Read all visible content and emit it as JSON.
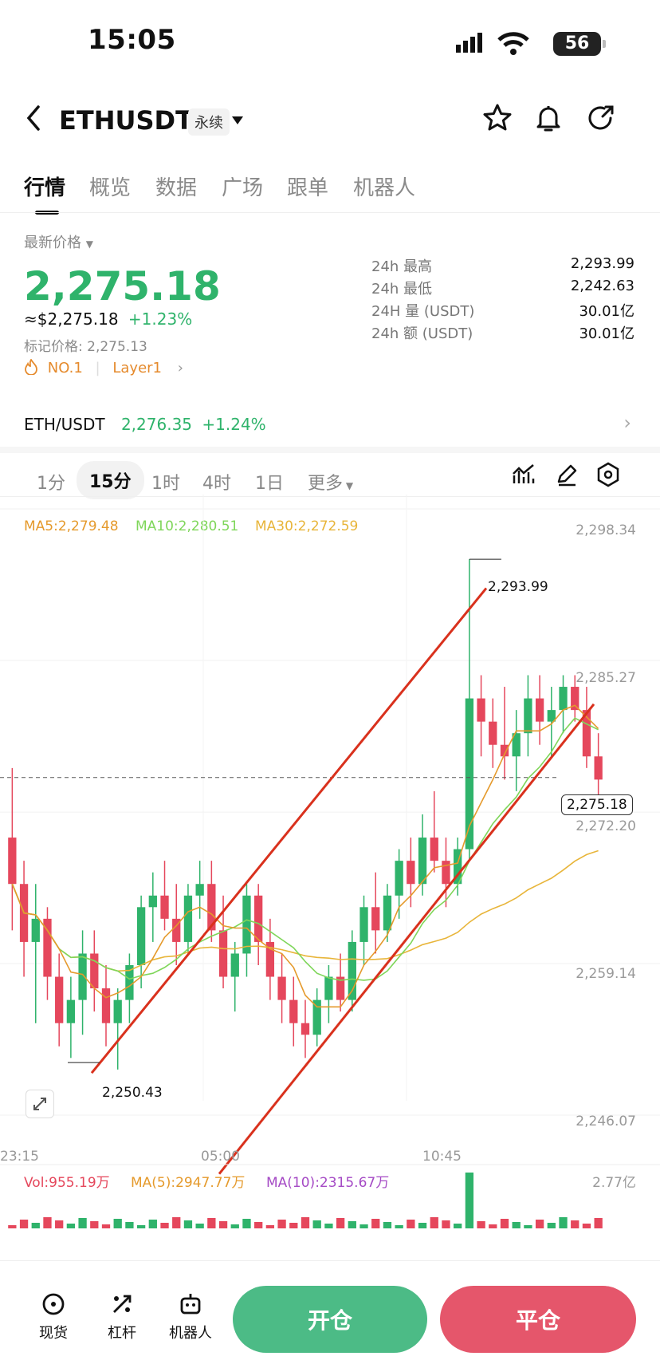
{
  "status": {
    "time": "15:05",
    "battery": "56"
  },
  "header": {
    "symbol": "ETHUSDT",
    "contract_tag": "永续"
  },
  "tabs": [
    {
      "label": "行情",
      "active": true
    },
    {
      "label": "概览"
    },
    {
      "label": "数据"
    },
    {
      "label": "广场"
    },
    {
      "label": "跟单"
    },
    {
      "label": "机器人"
    }
  ],
  "price": {
    "latest_label": "最新价格",
    "last": "2,275.18",
    "usd": "≈$2,275.18",
    "change": "+1.23%",
    "mark": "标记价格: 2,275.13",
    "rank": "NO.1",
    "sector": "Layer1"
  },
  "stats": [
    {
      "label": "24h  最高",
      "value": "2,293.99"
    },
    {
      "label": "24h  最低",
      "value": "2,242.63"
    },
    {
      "label": "24H  量 (USDT)",
      "value": "30.01亿"
    },
    {
      "label": "24h  额 (USDT)",
      "value": "30.01亿"
    }
  ],
  "spot": {
    "pair": "ETH/USDT",
    "price": "2,276.35",
    "change": "+1.24%"
  },
  "intervals": [
    {
      "label": "1分"
    },
    {
      "label": "15分",
      "active": true
    },
    {
      "label": "1时"
    },
    {
      "label": "4时"
    },
    {
      "label": "1日"
    },
    {
      "label": "更多"
    }
  ],
  "ma": {
    "ma5": "MA5:2,279.48",
    "ma10": "MA10:2,280.51",
    "ma30": "MA30:2,272.59"
  },
  "chart_data": {
    "type": "candlestick",
    "y_ticks": [
      "2,298.34",
      "2,285.27",
      "2,272.20",
      "2,259.14",
      "2,246.07"
    ],
    "ylim": [
      2246.07,
      2298.34
    ],
    "x_ticks": [
      "23:15",
      "05:00",
      "10:45"
    ],
    "current_price": "2,275.18",
    "high_marker": "2,293.99",
    "low_marker": "2,250.43",
    "candles": [
      [
        2270,
        2276,
        2262,
        2266
      ],
      [
        2266,
        2268,
        2258,
        2261
      ],
      [
        2261,
        2266,
        2254,
        2263
      ],
      [
        2263,
        2264,
        2256,
        2258
      ],
      [
        2258,
        2260,
        2252,
        2254
      ],
      [
        2254,
        2258,
        2251,
        2256
      ],
      [
        2256,
        2262,
        2253,
        2260
      ],
      [
        2260,
        2262,
        2255,
        2257
      ],
      [
        2257,
        2259,
        2252,
        2254
      ],
      [
        2254,
        2257,
        2250,
        2256
      ],
      [
        2256,
        2260,
        2254,
        2259
      ],
      [
        2259,
        2265,
        2257,
        2264
      ],
      [
        2264,
        2267,
        2261,
        2265
      ],
      [
        2265,
        2268,
        2262,
        2263
      ],
      [
        2263,
        2266,
        2259,
        2261
      ],
      [
        2261,
        2266,
        2260,
        2265
      ],
      [
        2265,
        2268,
        2263,
        2266
      ],
      [
        2266,
        2268,
        2261,
        2262
      ],
      [
        2262,
        2265,
        2257,
        2258
      ],
      [
        2258,
        2261,
        2255,
        2260
      ],
      [
        2260,
        2266,
        2258,
        2265
      ],
      [
        2265,
        2266,
        2259,
        2261
      ],
      [
        2261,
        2263,
        2256,
        2258
      ],
      [
        2258,
        2260,
        2254,
        2256
      ],
      [
        2256,
        2258,
        2252,
        2254
      ],
      [
        2254,
        2256,
        2251,
        2253
      ],
      [
        2253,
        2257,
        2252,
        2256
      ],
      [
        2256,
        2259,
        2254,
        2258
      ],
      [
        2258,
        2260,
        2255,
        2256
      ],
      [
        2256,
        2262,
        2255,
        2261
      ],
      [
        2261,
        2265,
        2259,
        2264
      ],
      [
        2264,
        2267,
        2260,
        2262
      ],
      [
        2262,
        2266,
        2261,
        2265
      ],
      [
        2265,
        2269,
        2263,
        2268
      ],
      [
        2268,
        2270,
        2264,
        2266
      ],
      [
        2266,
        2272,
        2265,
        2270
      ],
      [
        2270,
        2274,
        2267,
        2268
      ],
      [
        2268,
        2270,
        2264,
        2266
      ],
      [
        2266,
        2270,
        2265,
        2269
      ],
      [
        2269,
        2294,
        2268,
        2282
      ],
      [
        2282,
        2284,
        2277,
        2280
      ],
      [
        2280,
        2282,
        2276,
        2278
      ],
      [
        2278,
        2283,
        2275,
        2277
      ],
      [
        2277,
        2281,
        2274,
        2279
      ],
      [
        2279,
        2284,
        2277,
        2282
      ],
      [
        2282,
        2284,
        2278,
        2280
      ],
      [
        2280,
        2283,
        2277,
        2281
      ],
      [
        2281,
        2284,
        2279,
        2283
      ],
      [
        2283,
        2284,
        2280,
        2281
      ],
      [
        2281,
        2283,
        2276,
        2277
      ],
      [
        2277,
        2279,
        2273,
        2275
      ]
    ],
    "volume": {
      "vol": "Vol:955.19万",
      "ma5": "MA(5):2947.77万",
      "ma10": "MA(10):2315.67万",
      "top_tick": "2.77亿"
    }
  },
  "bottom_nav": [
    {
      "label": "现货",
      "icon": "spot-icon"
    },
    {
      "label": "杠杆",
      "icon": "leverage-icon"
    },
    {
      "label": "机器人",
      "icon": "robot-icon"
    }
  ],
  "actions": {
    "open": "开仓",
    "close": "平仓"
  },
  "colors": {
    "up": "#2fb36b",
    "down": "#e5475c",
    "ma5": "#e59a2c",
    "ma10": "#7fd65a",
    "ma30": "#e8b53a",
    "trend": "#d9311d"
  }
}
